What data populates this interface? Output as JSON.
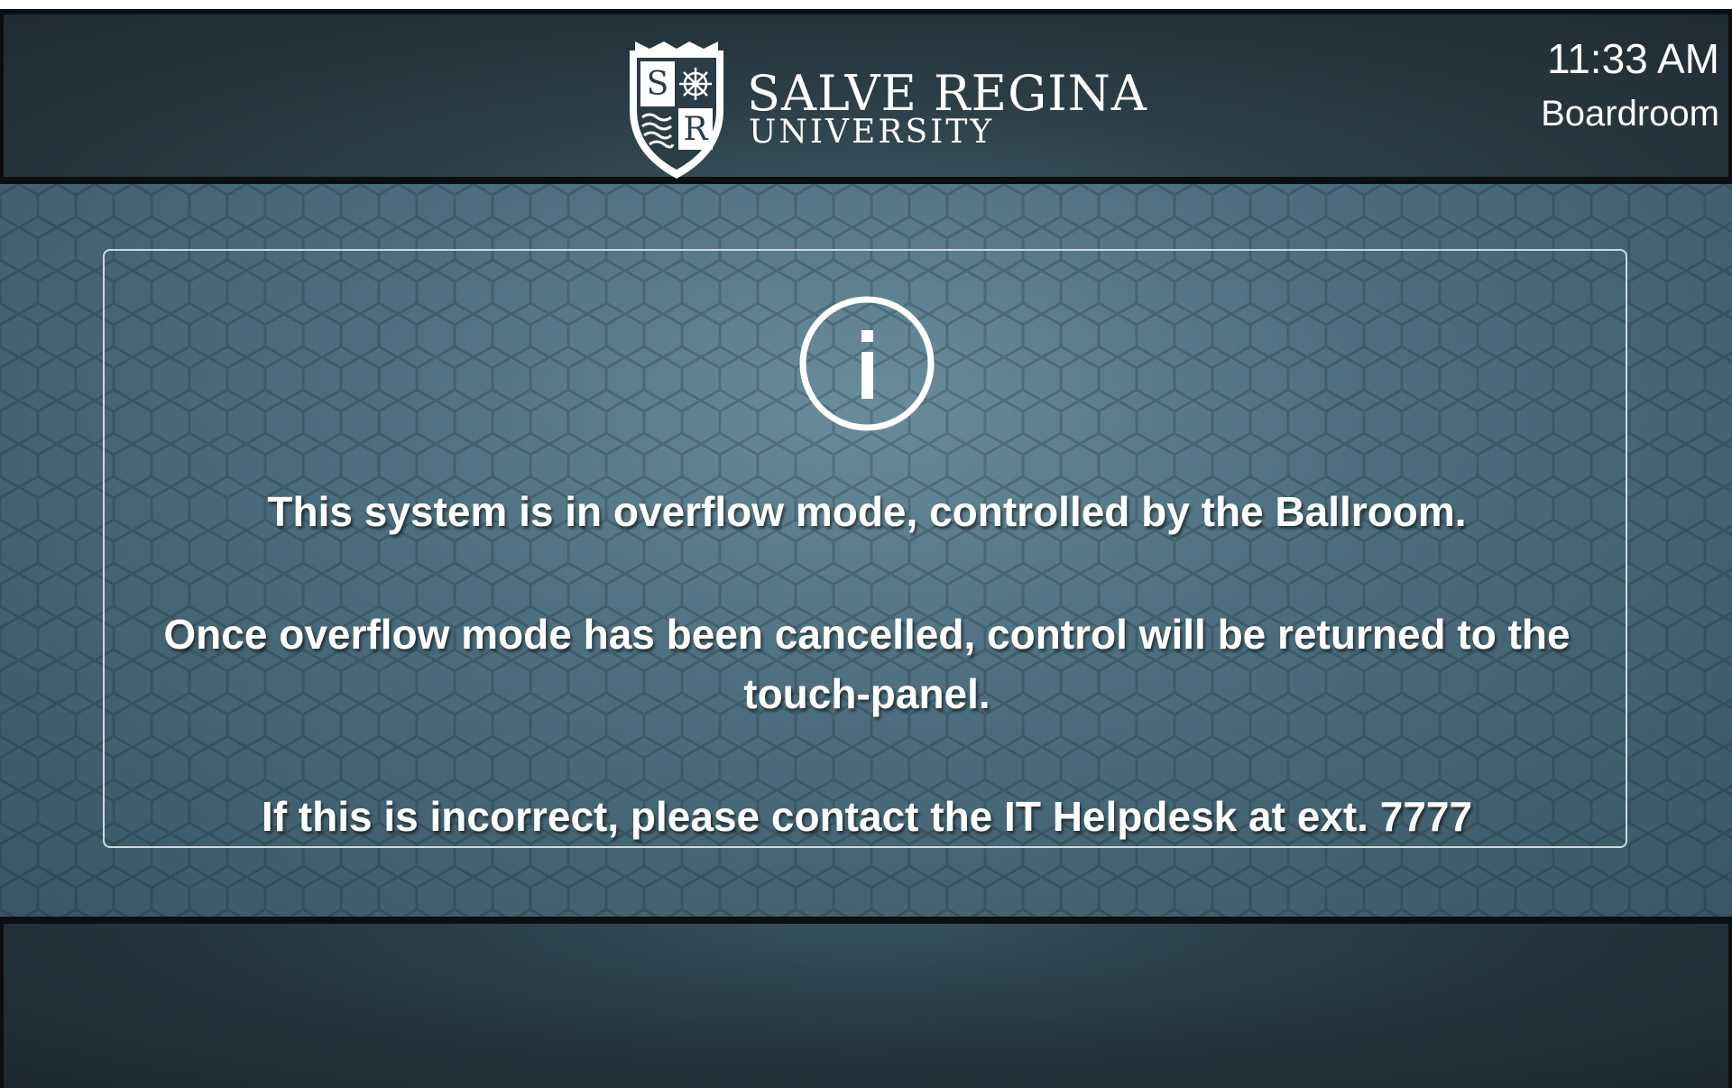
{
  "header": {
    "brand_line1": "SALVE REGINA",
    "brand_line2": "UNIVERSITY",
    "shield_letters": [
      "S",
      "R"
    ],
    "time": "11:33 AM",
    "room": "Boardroom"
  },
  "message": {
    "line1": "This system is in overflow mode, controlled by the Ballroom.",
    "line2": "Once overflow mode has been cancelled, control will be returned to the touch-panel.",
    "line3": "If this is incorrect, please contact the IT Helpdesk at ext. 7777",
    "icon": "info-icon"
  },
  "colors": {
    "header_bg": "#2a3c46",
    "main_bg": "#4d6f7f",
    "text": "#ffffff"
  }
}
